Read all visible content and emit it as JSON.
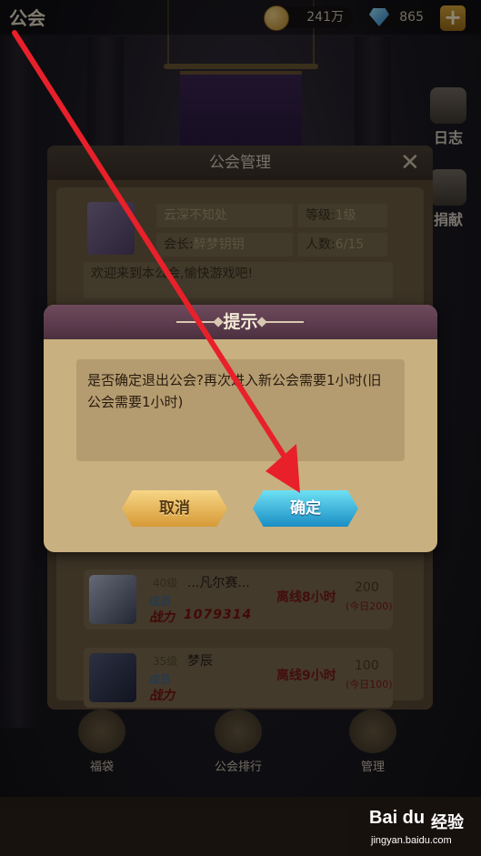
{
  "header": {
    "title": "公会",
    "gold": "241万",
    "gems": "865",
    "add_label": "+"
  },
  "side": {
    "log_label": "日志",
    "donate_label": "捐献"
  },
  "panel": {
    "title": "公会管理",
    "close_label": "✕",
    "guild_name": "云深不知处",
    "level_label": "等级:",
    "level_value": "1级",
    "leader_label": "会长:",
    "leader_value": "醉梦钥钥",
    "members_label": "人数:",
    "members_value": "6/15",
    "notice": "欢迎来到本公会,愉快游戏吧!"
  },
  "members": [
    {
      "level": "40级",
      "name": "...凡尔赛...",
      "role": "成员",
      "power_label": "战力",
      "power": "1079314",
      "status": "离线8小时",
      "contrib": "200",
      "today": "(今日200)"
    },
    {
      "level": "35级",
      "name": "梦辰",
      "role": "成员",
      "power_label": "战力",
      "power": "",
      "status": "离线9小时",
      "contrib": "100",
      "today": "(今日100)"
    }
  ],
  "bottom_nav": [
    "福袋",
    "公会排行",
    "管理"
  ],
  "dialog": {
    "title": "提示",
    "message": "是否确定退出公会?再次进入新公会需要1小时(旧公会需要1小时)",
    "cancel_label": "取消",
    "confirm_label": "确定"
  },
  "watermark": {
    "logo": "Bai du",
    "name": "经验",
    "url": "jingyan.baidu.com"
  },
  "colors": {
    "dialog_bg": "#c9b080",
    "dialog_header": "#5c3c4e",
    "cancel_button": "#e6b45a",
    "confirm_button": "#3ab4dc",
    "arrow": "#e8202a"
  }
}
